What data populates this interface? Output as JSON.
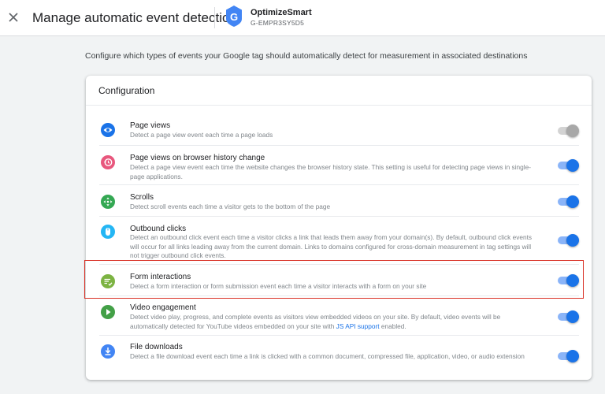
{
  "header": {
    "title": "Manage automatic event detection",
    "account_name": "OptimizeSmart",
    "account_id": "G-EMPR3SY5D5"
  },
  "description": "Configure which types of events your Google tag should automatically detect for measurement in associated destinations",
  "card": {
    "title": "Configuration",
    "rows": [
      {
        "title": "Page views",
        "description": "Detect a page view event each time a page loads",
        "icon": "eye-icon",
        "icon_color": "#1a73e8",
        "enabled": false
      },
      {
        "title": "Page views on browser history change",
        "description": "Detect a page view event each time the website changes the browser history state. This setting is useful for detecting page views in single-page applications.",
        "icon": "history-icon",
        "icon_color": "#e8577d",
        "enabled": true
      },
      {
        "title": "Scrolls",
        "description": "Detect scroll events each time a visitor gets to the bottom of the page",
        "icon": "scroll-arrows-icon",
        "icon_color": "#34a853",
        "enabled": true
      },
      {
        "title": "Outbound clicks",
        "description": "Detect an outbound click event each time a visitor clicks a link that leads them away from your domain(s). By default, outbound click events will occur for all links leading away from the current domain. Links to domains configured for cross-domain measurement in tag settings will not trigger outbound click events.",
        "icon": "mouse-icon",
        "icon_color": "#24b6f4",
        "enabled": true
      },
      {
        "title": "Form interactions",
        "description": "Detect a form interaction or form submission event each time a visitor interacts with a form on your site",
        "icon": "form-icon",
        "icon_color": "#7cb342",
        "enabled": true
      },
      {
        "title": "Video engagement",
        "description_before_link": "Detect video play, progress, and complete events as visitors view embedded videos on your site. By default, video events will be automatically detected for YouTube videos embedded on your site with ",
        "link_text": "JS API support",
        "description_after_link": " enabled.",
        "icon": "play-icon",
        "icon_color": "#43a047",
        "enabled": true
      },
      {
        "title": "File downloads",
        "description": "Detect a file download event each time a link is clicked with a common document, compressed file, application, video, or audio extension",
        "icon": "download-icon",
        "icon_color": "#4285f4",
        "enabled": true
      }
    ]
  },
  "colors": {
    "accent": "#1a73e8",
    "highlight": "#d93025"
  }
}
